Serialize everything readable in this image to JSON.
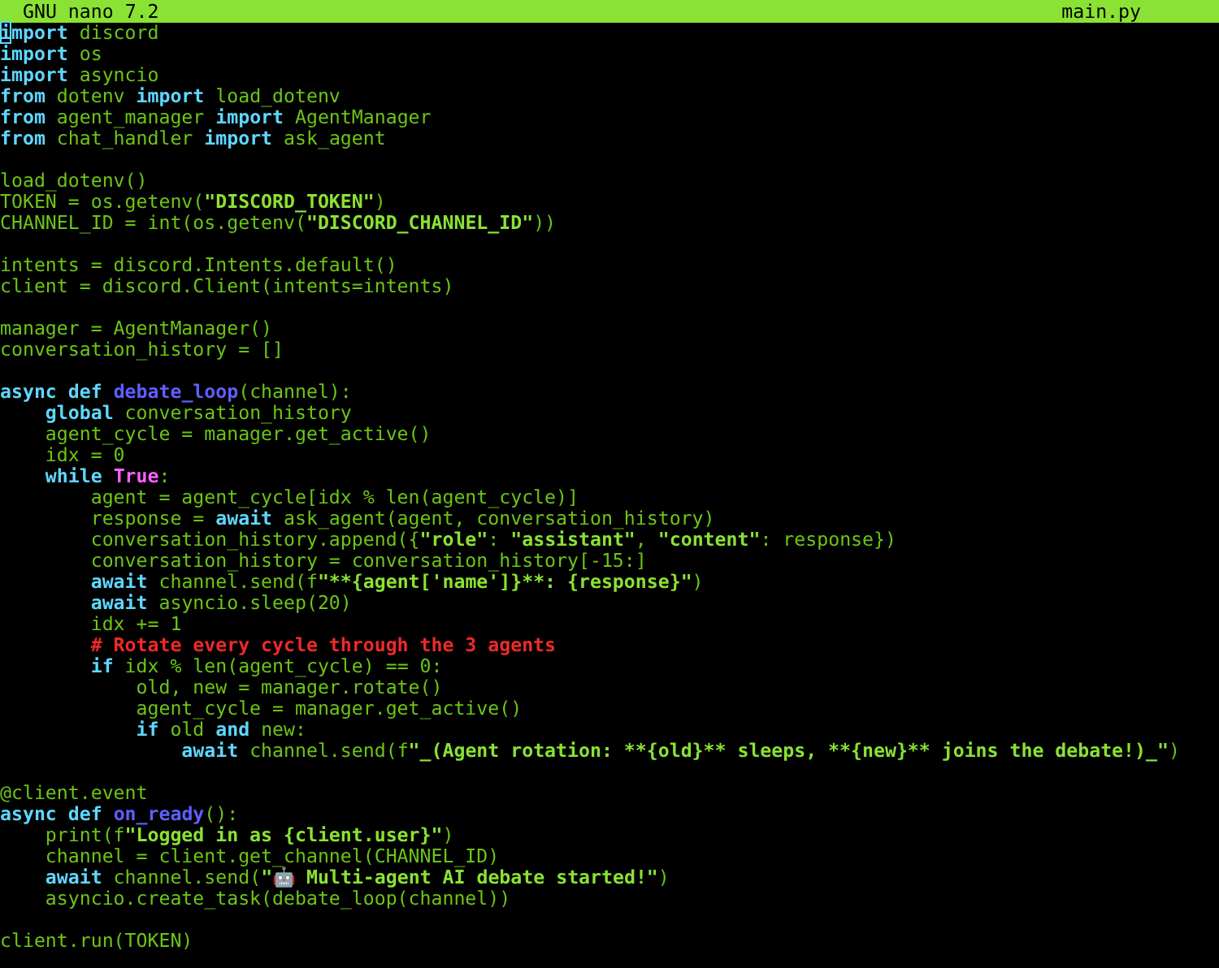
{
  "title_bar": {
    "app": "GNU nano 7.2",
    "file": "main.py"
  },
  "lines": [
    {
      "kind": "code",
      "segments": [
        {
          "kind": "cursor",
          "text": "i"
        },
        {
          "kind": "keyword",
          "text": "mport"
        },
        {
          "kind": "plain",
          "text": " discord"
        }
      ]
    },
    {
      "kind": "code",
      "segments": [
        {
          "kind": "keyword",
          "text": "import"
        },
        {
          "kind": "plain",
          "text": " os"
        }
      ]
    },
    {
      "kind": "code",
      "segments": [
        {
          "kind": "keyword",
          "text": "import"
        },
        {
          "kind": "plain",
          "text": " asyncio"
        }
      ]
    },
    {
      "kind": "code",
      "segments": [
        {
          "kind": "keyword",
          "text": "from"
        },
        {
          "kind": "plain",
          "text": " dotenv "
        },
        {
          "kind": "keyword",
          "text": "import"
        },
        {
          "kind": "plain",
          "text": " load_dotenv"
        }
      ]
    },
    {
      "kind": "code",
      "segments": [
        {
          "kind": "keyword",
          "text": "from"
        },
        {
          "kind": "plain",
          "text": " agent_manager "
        },
        {
          "kind": "keyword",
          "text": "import"
        },
        {
          "kind": "plain",
          "text": " AgentManager"
        }
      ]
    },
    {
      "kind": "code",
      "segments": [
        {
          "kind": "keyword",
          "text": "from"
        },
        {
          "kind": "plain",
          "text": " chat_handler "
        },
        {
          "kind": "keyword",
          "text": "import"
        },
        {
          "kind": "plain",
          "text": " ask_agent"
        }
      ]
    },
    {
      "kind": "blank"
    },
    {
      "kind": "code",
      "segments": [
        {
          "kind": "plain",
          "text": "load_dotenv()"
        }
      ]
    },
    {
      "kind": "code",
      "segments": [
        {
          "kind": "plain",
          "text": "TOKEN = os.getenv("
        },
        {
          "kind": "string",
          "text": "\"DISCORD_TOKEN\""
        },
        {
          "kind": "plain",
          "text": ")"
        }
      ]
    },
    {
      "kind": "code",
      "segments": [
        {
          "kind": "plain",
          "text": "CHANNEL_ID = int(os.getenv("
        },
        {
          "kind": "string",
          "text": "\"DISCORD_CHANNEL_ID\""
        },
        {
          "kind": "plain",
          "text": "))"
        }
      ]
    },
    {
      "kind": "blank"
    },
    {
      "kind": "code",
      "segments": [
        {
          "kind": "plain",
          "text": "intents = discord.Intents.default()"
        }
      ]
    },
    {
      "kind": "code",
      "segments": [
        {
          "kind": "plain",
          "text": "client = discord.Client(intents=intents)"
        }
      ]
    },
    {
      "kind": "blank"
    },
    {
      "kind": "code",
      "segments": [
        {
          "kind": "plain",
          "text": "manager = AgentManager()"
        }
      ]
    },
    {
      "kind": "code",
      "segments": [
        {
          "kind": "plain",
          "text": "conversation_history = []"
        }
      ]
    },
    {
      "kind": "blank"
    },
    {
      "kind": "code",
      "segments": [
        {
          "kind": "keyword",
          "text": "async def "
        },
        {
          "kind": "function",
          "text": "debate_loop"
        },
        {
          "kind": "plain",
          "text": "(channel):"
        }
      ]
    },
    {
      "kind": "code",
      "segments": [
        {
          "kind": "keyword",
          "text": "    global"
        },
        {
          "kind": "plain",
          "text": " conversation_history"
        }
      ]
    },
    {
      "kind": "code",
      "segments": [
        {
          "kind": "plain",
          "text": "    agent_cycle = manager.get_active()"
        }
      ]
    },
    {
      "kind": "code",
      "segments": [
        {
          "kind": "plain",
          "text": "    idx = 0"
        }
      ]
    },
    {
      "kind": "code",
      "segments": [
        {
          "kind": "keyword",
          "text": "    while "
        },
        {
          "kind": "constant",
          "text": "True"
        },
        {
          "kind": "plain",
          "text": ":"
        }
      ]
    },
    {
      "kind": "code",
      "segments": [
        {
          "kind": "plain",
          "text": "        agent = agent_cycle[idx % len(agent_cycle)]"
        }
      ]
    },
    {
      "kind": "code",
      "segments": [
        {
          "kind": "plain",
          "text": "        response = "
        },
        {
          "kind": "keyword",
          "text": "await"
        },
        {
          "kind": "plain",
          "text": " ask_agent(agent, conversation_history)"
        }
      ]
    },
    {
      "kind": "code",
      "segments": [
        {
          "kind": "plain",
          "text": "        conversation_history.append({"
        },
        {
          "kind": "string",
          "text": "\"role\""
        },
        {
          "kind": "plain",
          "text": ": "
        },
        {
          "kind": "string",
          "text": "\"assistant\""
        },
        {
          "kind": "plain",
          "text": ", "
        },
        {
          "kind": "string",
          "text": "\"content\""
        },
        {
          "kind": "plain",
          "text": ": response})"
        }
      ]
    },
    {
      "kind": "code",
      "segments": [
        {
          "kind": "plain",
          "text": "        conversation_history = conversation_history[-15:]"
        }
      ]
    },
    {
      "kind": "code",
      "segments": [
        {
          "kind": "keyword",
          "text": "        await"
        },
        {
          "kind": "plain",
          "text": " channel.send(f"
        },
        {
          "kind": "string",
          "text": "\"**{agent['name']}**: {response}\""
        },
        {
          "kind": "plain",
          "text": ")"
        }
      ]
    },
    {
      "kind": "code",
      "segments": [
        {
          "kind": "keyword",
          "text": "        await"
        },
        {
          "kind": "plain",
          "text": " asyncio.sleep(20)"
        }
      ]
    },
    {
      "kind": "code",
      "segments": [
        {
          "kind": "plain",
          "text": "        idx += 1"
        }
      ]
    },
    {
      "kind": "code",
      "segments": [
        {
          "kind": "comment",
          "text": "        # Rotate every cycle through the 3 agents"
        }
      ]
    },
    {
      "kind": "code",
      "segments": [
        {
          "kind": "keyword",
          "text": "        if"
        },
        {
          "kind": "plain",
          "text": " idx % len(agent_cycle) == 0:"
        }
      ]
    },
    {
      "kind": "code",
      "segments": [
        {
          "kind": "plain",
          "text": "            old, new = manager.rotate()"
        }
      ]
    },
    {
      "kind": "code",
      "segments": [
        {
          "kind": "plain",
          "text": "            agent_cycle = manager.get_active()"
        }
      ]
    },
    {
      "kind": "code",
      "segments": [
        {
          "kind": "keyword",
          "text": "            if"
        },
        {
          "kind": "plain",
          "text": " old "
        },
        {
          "kind": "keyword",
          "text": "and"
        },
        {
          "kind": "plain",
          "text": " new:"
        }
      ]
    },
    {
      "kind": "code",
      "segments": [
        {
          "kind": "keyword",
          "text": "                await"
        },
        {
          "kind": "plain",
          "text": " channel.send(f"
        },
        {
          "kind": "string",
          "text": "\"_(Agent rotation: **{old}** sleeps, **{new}** joins the debate!)_\""
        },
        {
          "kind": "plain",
          "text": ")"
        }
      ]
    },
    {
      "kind": "blank"
    },
    {
      "kind": "code",
      "segments": [
        {
          "kind": "plain",
          "text": "@client.event"
        }
      ]
    },
    {
      "kind": "code",
      "segments": [
        {
          "kind": "keyword",
          "text": "async def "
        },
        {
          "kind": "function",
          "text": "on_ready"
        },
        {
          "kind": "plain",
          "text": "():"
        }
      ]
    },
    {
      "kind": "code",
      "segments": [
        {
          "kind": "plain",
          "text": "    print(f"
        },
        {
          "kind": "string",
          "text": "\"Logged in as {client.user}\""
        },
        {
          "kind": "plain",
          "text": ")"
        }
      ]
    },
    {
      "kind": "code",
      "segments": [
        {
          "kind": "plain",
          "text": "    channel = client.get_channel(CHANNEL_ID)"
        }
      ]
    },
    {
      "kind": "code",
      "segments": [
        {
          "kind": "keyword",
          "text": "    await"
        },
        {
          "kind": "plain",
          "text": " channel.send("
        },
        {
          "kind": "string",
          "text": "\"🤖 Multi-agent AI debate started!\""
        },
        {
          "kind": "plain",
          "text": ")"
        }
      ]
    },
    {
      "kind": "code",
      "segments": [
        {
          "kind": "plain",
          "text": "    asyncio.create_task(debate_loop(channel))"
        }
      ]
    },
    {
      "kind": "blank"
    },
    {
      "kind": "code",
      "segments": [
        {
          "kind": "plain",
          "text": "client.run(TOKEN)"
        }
      ]
    }
  ]
}
